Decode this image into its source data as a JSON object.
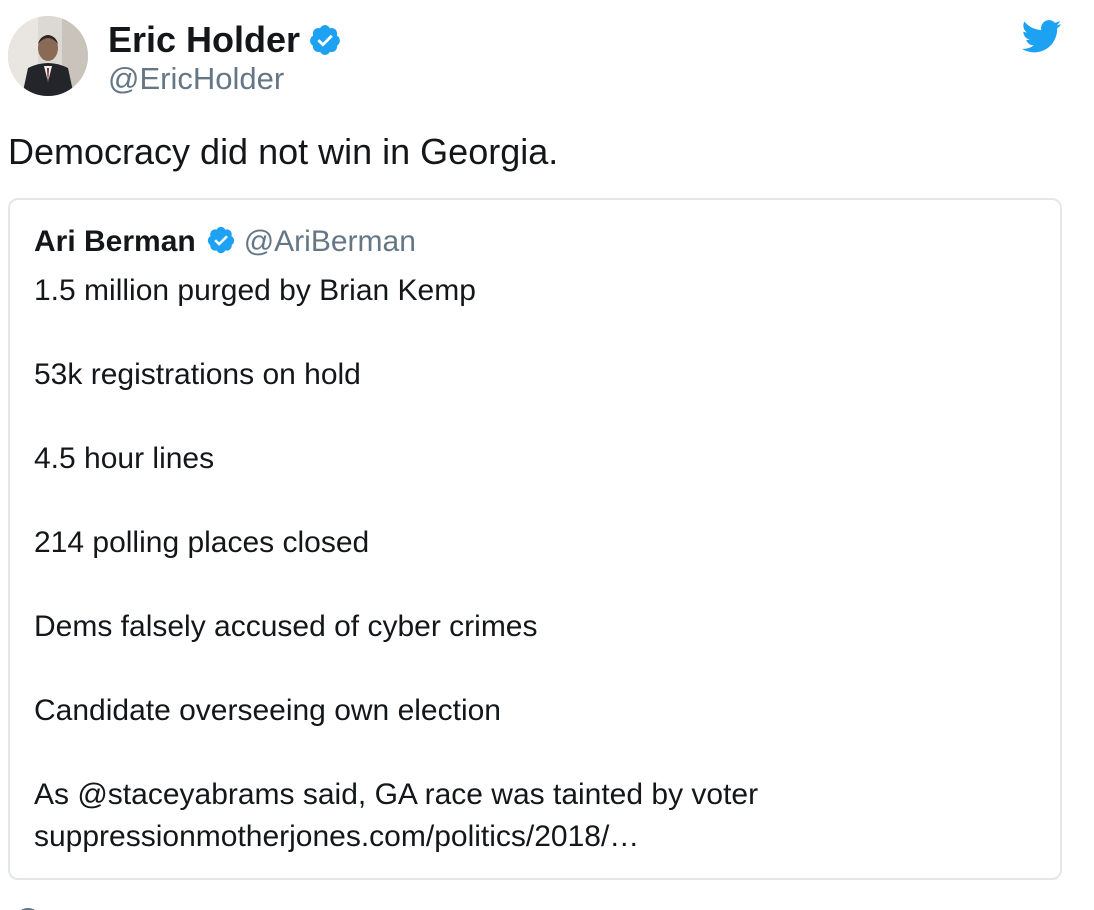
{
  "tweet": {
    "author": {
      "display_name": "Eric Holder",
      "handle": "@EricHolder",
      "verified": true
    },
    "text": "Democracy did not win in Georgia.",
    "quoted_tweet": {
      "author": {
        "display_name": "Ari Berman",
        "handle": "@AriBerman",
        "verified": true
      },
      "lines": [
        "1.5 million purged by Brian Kemp",
        "53k registrations on hold",
        "4.5 hour lines",
        "214 polling places closed",
        "Dems falsely accused of cyber crimes",
        "Candidate overseeing own election",
        "As @staceyabrams said, GA race was tainted by voter",
        "suppressionmotherjones.com/politics/2018/…"
      ]
    }
  },
  "icons": {
    "brand": "twitter-bird-icon",
    "verified": "verified-badge-icon"
  },
  "colors": {
    "twitter_blue": "#1da1f2",
    "text_primary": "#14171a",
    "text_secondary": "#657786",
    "border": "#e1e8ed"
  }
}
